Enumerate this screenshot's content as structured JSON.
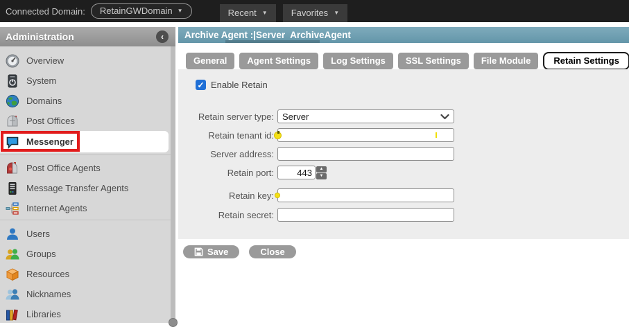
{
  "topbar": {
    "connected_domain_label": "Connected Domain:",
    "domain_value": "RetainGWDomain",
    "recent_label": "Recent",
    "favorites_label": "Favorites"
  },
  "glyphs": {
    "caret_down": "▼",
    "collapse": "‹",
    "check": "✓",
    "spinner_up": "▲",
    "spinner_down": "▼"
  },
  "sidebar": {
    "title": "Administration",
    "items": [
      {
        "label": "Overview",
        "icon": "gauge-icon"
      },
      {
        "label": "System",
        "icon": "power-icon"
      },
      {
        "label": "Domains",
        "icon": "globe-icon"
      },
      {
        "label": "Post Offices",
        "icon": "mailbox-icon"
      },
      {
        "label": "Messenger",
        "icon": "chat-bubble-icon",
        "selected": true,
        "annotated": true
      },
      {
        "label": "Post Office Agents",
        "icon": "mailbox-flag-icon"
      },
      {
        "label": "Message Transfer Agents",
        "icon": "server-icon"
      },
      {
        "label": "Internet Agents",
        "icon": "network-icon"
      },
      {
        "label": "Users",
        "icon": "user-icon"
      },
      {
        "label": "Groups",
        "icon": "group-icon"
      },
      {
        "label": "Resources",
        "icon": "cube-icon"
      },
      {
        "label": "Nicknames",
        "icon": "nicknames-icon"
      },
      {
        "label": "Libraries",
        "icon": "books-icon"
      }
    ]
  },
  "main": {
    "title": "Archive Agent :|Server  ArchiveAgent",
    "tabs": [
      {
        "label": "General",
        "active": false
      },
      {
        "label": "Agent Settings",
        "active": false
      },
      {
        "label": "Log Settings",
        "active": false
      },
      {
        "label": "SSL Settings",
        "active": false
      },
      {
        "label": "File Module",
        "active": false
      },
      {
        "label": "Retain Settings",
        "active": true
      }
    ],
    "form": {
      "enable_retain_label": "Enable Retain",
      "enable_retain_checked": true,
      "fields": [
        {
          "label": "Retain server type:",
          "type": "select",
          "value": "Server"
        },
        {
          "label": "Retain tenant id:",
          "type": "text",
          "value": "",
          "required": true
        },
        {
          "label": "Server address:",
          "type": "text",
          "value": ""
        },
        {
          "label": "Retain port:",
          "type": "number",
          "value": "443"
        },
        {
          "label": "Retain key:",
          "type": "text",
          "value": "",
          "required": true
        },
        {
          "label": "Retain secret:",
          "type": "text",
          "value": ""
        }
      ]
    },
    "buttons": {
      "save": "Save",
      "close": "Close"
    }
  },
  "colors": {
    "topbar_bg": "#1e1e1e",
    "header_teal": "#6f9fb1",
    "sidebar_bg": "#d7d7d7",
    "panel_bg": "#ededed",
    "accent_blue": "#1f6fd6",
    "annotation_red": "#e11c1c",
    "tab_gray": "#9a9a9a",
    "required_yellow": "#f4e016"
  }
}
